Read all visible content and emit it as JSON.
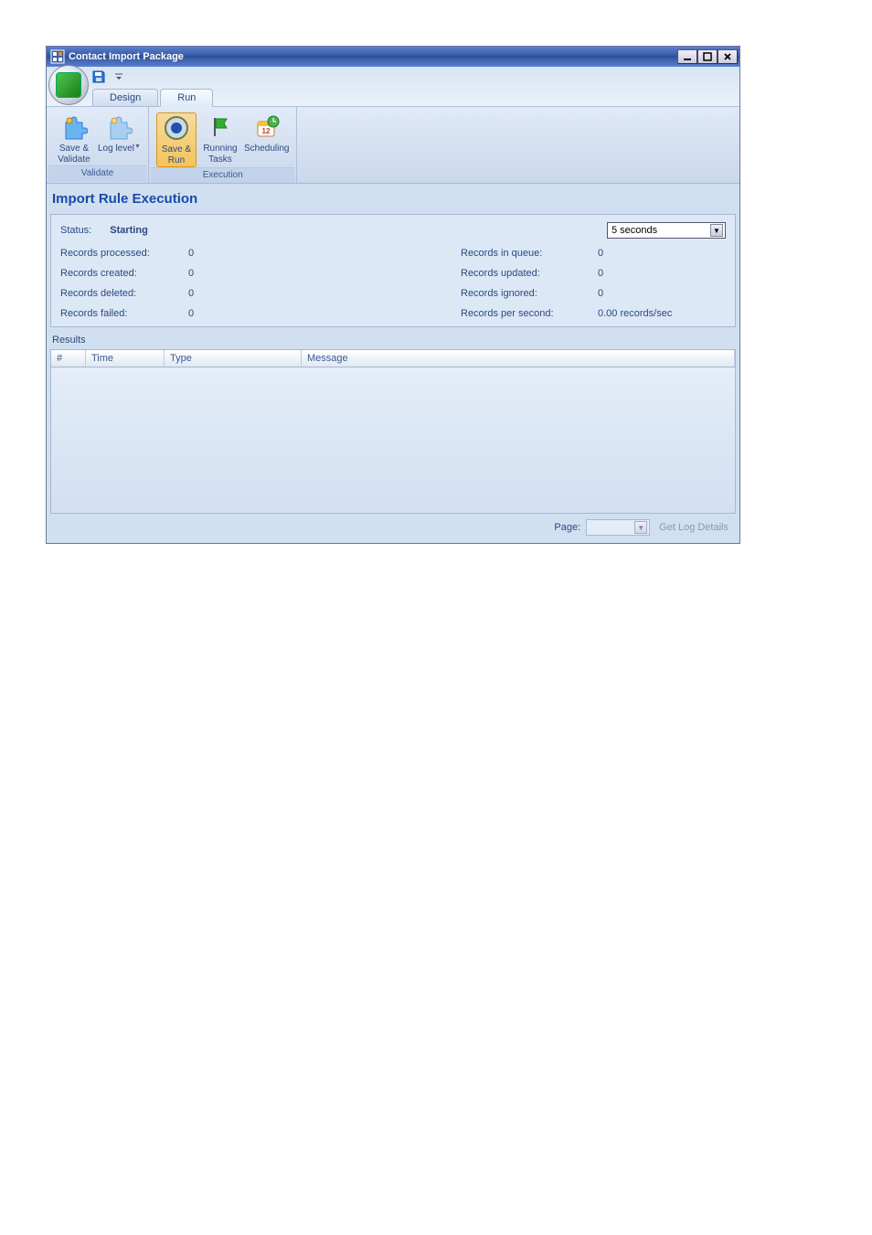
{
  "titlebar": {
    "title": "Contact Import Package"
  },
  "tabs": {
    "design": "Design",
    "run": "Run"
  },
  "ribbon": {
    "validate": {
      "save_validate": "Save &\nValidate",
      "log_level": "Log level",
      "group_label": "Validate"
    },
    "execution": {
      "save_run": "Save &\nRun",
      "running_tasks": "Running\nTasks",
      "scheduling": "Scheduling",
      "group_label": "Execution"
    }
  },
  "section_title": "Import Rule Execution",
  "status": {
    "label": "Status:",
    "value": "Starting",
    "refresh": "5 seconds",
    "records_processed_label": "Records processed:",
    "records_processed": "0",
    "records_in_queue_label": "Records in queue:",
    "records_in_queue": "0",
    "records_created_label": "Records created:",
    "records_created": "0",
    "records_updated_label": "Records updated:",
    "records_updated": "0",
    "records_deleted_label": "Records deleted:",
    "records_deleted": "0",
    "records_ignored_label": "Records ignored:",
    "records_ignored": "0",
    "records_failed_label": "Records failed:",
    "records_failed": "0",
    "records_per_second_label": "Records per second:",
    "records_per_second": "0.00 records/sec"
  },
  "results": {
    "section_label": "Results",
    "col_num": "#",
    "col_time": "Time",
    "col_type": "Type",
    "col_message": "Message"
  },
  "footer": {
    "page_label": "Page:",
    "get_log_details": "Get Log Details"
  }
}
